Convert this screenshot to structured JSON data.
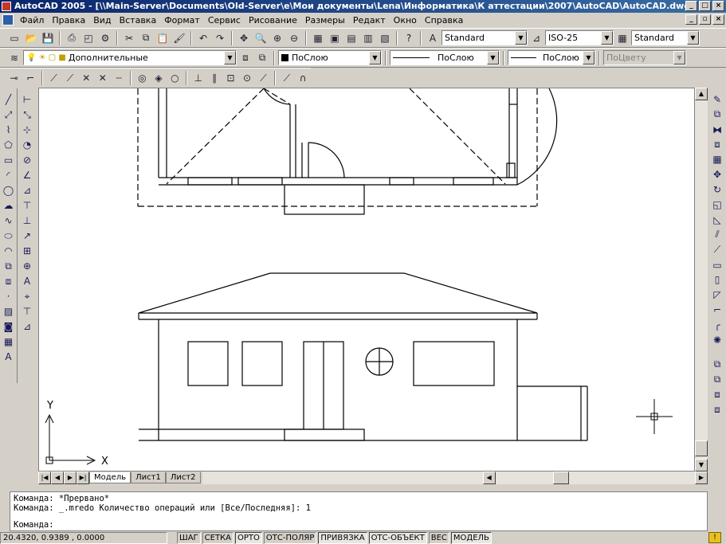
{
  "title": "AutoCAD 2005 - [\\\\Main-Server\\Documents\\Old-Server\\e\\Мои документы\\Lena\\Информатика\\К аттестации\\2007\\AutoCAD\\AutoCAD.dwg]",
  "menu": [
    "Файл",
    "Правка",
    "Вид",
    "Вставка",
    "Формат",
    "Сервис",
    "Рисование",
    "Размеры",
    "Редакт",
    "Окно",
    "Справка"
  ],
  "styles": {
    "text_style": "Standard",
    "dim_style": "ISO-25",
    "table_style": "Standard"
  },
  "layers": {
    "current": "Дополнительные",
    "color": "ПоСлою",
    "linetype": "ПоСлою",
    "lineweight": "ПоСлою",
    "plotstyle": "ПоЦвету"
  },
  "tabs": [
    "Модель",
    "Лист1",
    "Лист2"
  ],
  "command_lines": [
    "Команда: *Прервано*",
    "Команда: _.mredo Количество операций или [Все/Последняя]: 1",
    "Команда:"
  ],
  "coords": "20.4320, 0.9389 , 0.0000",
  "status_buttons": [
    "ШАГ",
    "СЕТКА",
    "ОРТО",
    "ОТС-ПОЛЯР",
    "ПРИВЯЗКА",
    "ОТС-ОБЪЕКТ",
    "ВЕС",
    "МОДЕЛЬ"
  ],
  "ucs": {
    "x": "X",
    "y": "Y"
  }
}
